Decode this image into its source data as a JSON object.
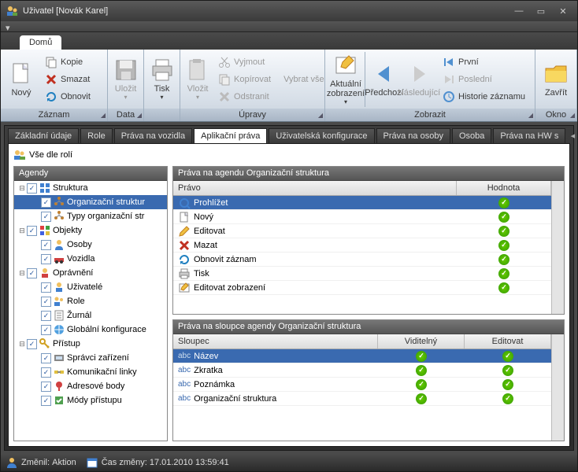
{
  "title": "Uživatel [Novák Karel]",
  "topTab": "Domů",
  "ribbon": {
    "groups": {
      "zaznam": "Záznam",
      "data": "Data",
      "upravy": "Úpravy",
      "zobrazit": "Zobrazit",
      "okno": "Okno"
    },
    "novy": "Nový",
    "kopie": "Kopie",
    "smazat": "Smazat",
    "obnovit": "Obnovit",
    "ulozit": "Uložit",
    "tisk": "Tisk",
    "vlozit": "Vložit",
    "vyjmout": "Vyjmout",
    "kopirovat": "Kopírovat",
    "odstranit": "Odstranit",
    "vybratvse": "Vybrat vše",
    "aktualni": "Aktuální zobrazení",
    "predchozi": "Předchozí",
    "nasledujici": "Následující",
    "prvni": "První",
    "posledni": "Poslední",
    "historie": "Historie záznamu",
    "zavrit": "Zavřít"
  },
  "lowerTabs": [
    "Základní údaje",
    "Role",
    "Práva na vozidla",
    "Aplikační práva",
    "Uživatelská konfigurace",
    "Práva na osoby",
    "Osoba",
    "Práva na HW s"
  ],
  "lowerActive": 3,
  "panelTitle": "Vše dle rolí",
  "treeHeader": "Agendy",
  "tree": [
    {
      "d": 0,
      "tw": "-",
      "cb": true,
      "ico": "struct",
      "t": "Struktura"
    },
    {
      "d": 1,
      "tw": "",
      "cb": true,
      "ico": "org",
      "t": "Organizační struktur",
      "sel": true
    },
    {
      "d": 1,
      "tw": "",
      "cb": true,
      "ico": "org",
      "t": "Typy organizační str"
    },
    {
      "d": 0,
      "tw": "-",
      "cb": true,
      "ico": "obj",
      "t": "Objekty"
    },
    {
      "d": 1,
      "tw": "",
      "cb": true,
      "ico": "person",
      "t": "Osoby"
    },
    {
      "d": 1,
      "tw": "",
      "cb": true,
      "ico": "car",
      "t": "Vozidla"
    },
    {
      "d": 0,
      "tw": "-",
      "cb": true,
      "ico": "perm",
      "t": "Oprávnění"
    },
    {
      "d": 1,
      "tw": "",
      "cb": true,
      "ico": "user",
      "t": "Uživatelé"
    },
    {
      "d": 1,
      "tw": "",
      "cb": true,
      "ico": "role",
      "t": "Role"
    },
    {
      "d": 1,
      "tw": "",
      "cb": true,
      "ico": "journal",
      "t": "Žurnál"
    },
    {
      "d": 1,
      "tw": "",
      "cb": true,
      "ico": "globe",
      "t": "Globální konfigurace"
    },
    {
      "d": 0,
      "tw": "-",
      "cb": true,
      "ico": "key",
      "t": "Přístup"
    },
    {
      "d": 1,
      "tw": "",
      "cb": true,
      "ico": "dev",
      "t": "Správci zařízení"
    },
    {
      "d": 1,
      "tw": "",
      "cb": true,
      "ico": "link",
      "t": "Komunikační linky"
    },
    {
      "d": 1,
      "tw": "",
      "cb": true,
      "ico": "point",
      "t": "Adresové body"
    },
    {
      "d": 1,
      "tw": "",
      "cb": true,
      "ico": "mode",
      "t": "Módy přístupu"
    }
  ],
  "grid1": {
    "title": "Práva na agendu Organizační struktura",
    "cols": [
      "Právo",
      "Hodnota"
    ],
    "rows": [
      {
        "ico": "view",
        "t": "Prohlížet",
        "v": true,
        "sel": true
      },
      {
        "ico": "new",
        "t": "Nový",
        "v": true
      },
      {
        "ico": "edit",
        "t": "Editovat",
        "v": true
      },
      {
        "ico": "del",
        "t": "Mazat",
        "v": true
      },
      {
        "ico": "refresh",
        "t": "Obnovit záznam",
        "v": true
      },
      {
        "ico": "print",
        "t": "Tisk",
        "v": true
      },
      {
        "ico": "editview",
        "t": "Editovat zobrazení",
        "v": true
      }
    ]
  },
  "grid2": {
    "title": "Práva na sloupce agendy Organizační struktura",
    "cols": [
      "Sloupec",
      "Viditelný",
      "Editovat"
    ],
    "rows": [
      {
        "t": "Název",
        "v": true,
        "e": true,
        "sel": true
      },
      {
        "t": "Zkratka",
        "v": true,
        "e": true
      },
      {
        "t": "Poznámka",
        "v": true,
        "e": true
      },
      {
        "t": "Organizační struktura",
        "v": true,
        "e": true
      }
    ]
  },
  "status": {
    "zmenil_lbl": "Změnil:",
    "zmenil": "Aktion",
    "cas_lbl": "Čas změny:",
    "cas": "17.01.2010 13:59:41"
  }
}
